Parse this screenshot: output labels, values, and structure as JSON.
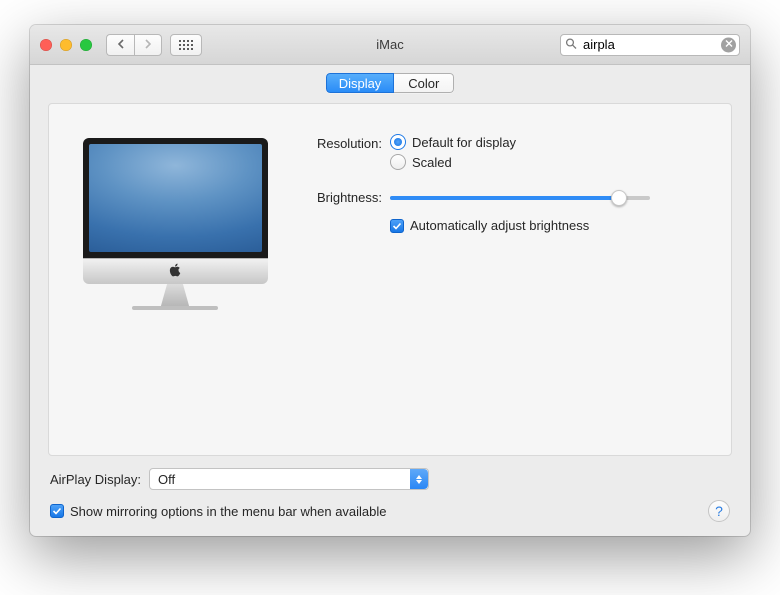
{
  "window": {
    "title": "iMac"
  },
  "search": {
    "value": "airpla"
  },
  "tabs": {
    "display": "Display",
    "color": "Color"
  },
  "resolution": {
    "label": "Resolution:",
    "default": "Default for display",
    "scaled": "Scaled"
  },
  "brightness": {
    "label": "Brightness:",
    "auto": "Automatically adjust brightness"
  },
  "airplay": {
    "label": "AirPlay Display:",
    "value": "Off"
  },
  "mirroring": {
    "label": "Show mirroring options in the menu bar when available"
  }
}
